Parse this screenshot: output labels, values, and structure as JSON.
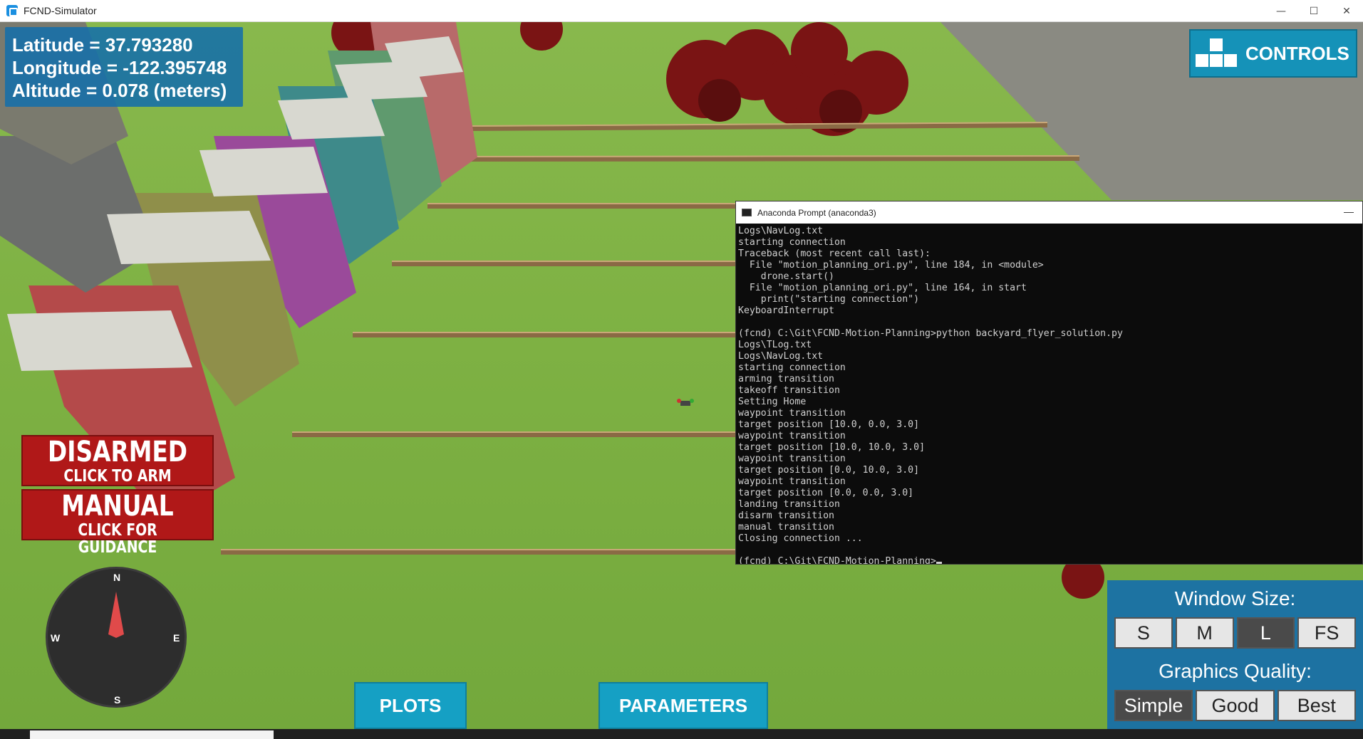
{
  "window": {
    "title": "FCND-Simulator",
    "minimize": "—",
    "maximize": "☐",
    "close": "✕"
  },
  "position": {
    "latitude": "Latitude = 37.793280",
    "longitude": "Longitude = -122.395748",
    "altitude": "Altitude = 0.078 (meters)"
  },
  "controls_button": {
    "label": "CONTROLS"
  },
  "status": {
    "arm_title": "DISARMED",
    "arm_subtitle": "CLICK TO ARM",
    "mode_title": "MANUAL",
    "mode_subtitle": "CLICK FOR GUIDANCE"
  },
  "compass": {
    "north": "N",
    "south": "S",
    "east": "E",
    "west": "W"
  },
  "bottom_buttons": {
    "plots": "PLOTS",
    "parameters": "PARAMETERS"
  },
  "settings": {
    "window_size_heading": "Window Size:",
    "window_sizes": [
      "S",
      "M",
      "L",
      "FS"
    ],
    "window_size_selected": "L",
    "graphics_heading": "Graphics Quality:",
    "graphics_options": [
      "Simple",
      "Good",
      "Best"
    ],
    "graphics_selected": "Simple"
  },
  "terminal": {
    "title": "Anaconda Prompt (anaconda3)",
    "minimize": "—",
    "lines": [
      "Logs\\NavLog.txt",
      "starting connection",
      "Traceback (most recent call last):",
      "  File \"motion_planning_ori.py\", line 184, in <module>",
      "    drone.start()",
      "  File \"motion_planning_ori.py\", line 164, in start",
      "    print(\"starting connection\")",
      "KeyboardInterrupt",
      "",
      "(fcnd) C:\\Git\\FCND-Motion-Planning>python backyard_flyer_solution.py",
      "Logs\\TLog.txt",
      "Logs\\NavLog.txt",
      "starting connection",
      "arming transition",
      "takeoff transition",
      "Setting Home",
      "waypoint transition",
      "target position [10.0, 0.0, 3.0]",
      "waypoint transition",
      "target position [10.0, 10.0, 3.0]",
      "waypoint transition",
      "target position [0.0, 10.0, 3.0]",
      "waypoint transition",
      "target position [0.0, 0.0, 3.0]",
      "landing transition",
      "disarm transition",
      "manual transition",
      "Closing connection ...",
      "",
      "(fcnd) C:\\Git\\FCND-Motion-Planning>"
    ]
  },
  "colors": {
    "panel_blue": "#1592b8",
    "status_red": "#b01818",
    "grass": "#7fb244",
    "terminal_bg": "#0c0c0c"
  }
}
